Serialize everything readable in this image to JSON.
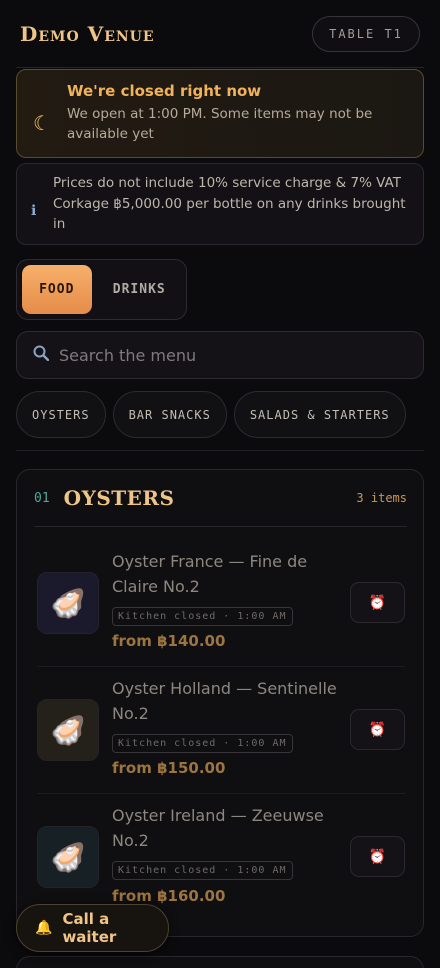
{
  "header": {
    "venue": "Demo Venue",
    "table": "TABLE T1"
  },
  "closed_notice": {
    "title": "We're closed right now",
    "text": "We open at 1:00 PM. Some items may not be available yet"
  },
  "info_notice": {
    "line1": "Prices do not include 10% service charge & 7% VAT",
    "line2": "Corkage ฿5,000.00 per bottle on any drinks brought in"
  },
  "segments": {
    "food": "FOOD",
    "drinks": "DRINKS",
    "active": "food"
  },
  "search": {
    "placeholder": "Search the menu",
    "value": ""
  },
  "chips": [
    "OYSTERS",
    "BAR SNACKS",
    "SALADS & STARTERS"
  ],
  "section": {
    "number": "01",
    "title": "OYSTERS",
    "count": "3 items",
    "items": [
      {
        "name": "Oyster France — Fine de Claire No.2",
        "badge": "Kitchen closed · 1:00 AM",
        "price": "from ฿140.00",
        "thumb_color": "#1a1a2c"
      },
      {
        "name": "Oyster Holland — Sentinelle No.2",
        "badge": "Kitchen closed · 1:00 AM",
        "price": "from ฿150.00",
        "thumb_color": "#23211a"
      },
      {
        "name": "Oyster Ireland — Zeeuwse No.2",
        "badge": "Kitchen closed · 1:00 AM",
        "price": "from ฿160.00",
        "thumb_color": "#172025"
      }
    ]
  },
  "waiter_button": "Call a waiter",
  "icons": {
    "closed": "moon-icon",
    "info": "info-icon",
    "search": "search-icon",
    "item_action": "alarm-clock-icon",
    "waiter": "bell-icon"
  },
  "colors": {
    "accent": "#efc587",
    "active_tab": "#f0a25e",
    "closed_title": "#f0b35a",
    "section_number": "#4fa89c"
  }
}
